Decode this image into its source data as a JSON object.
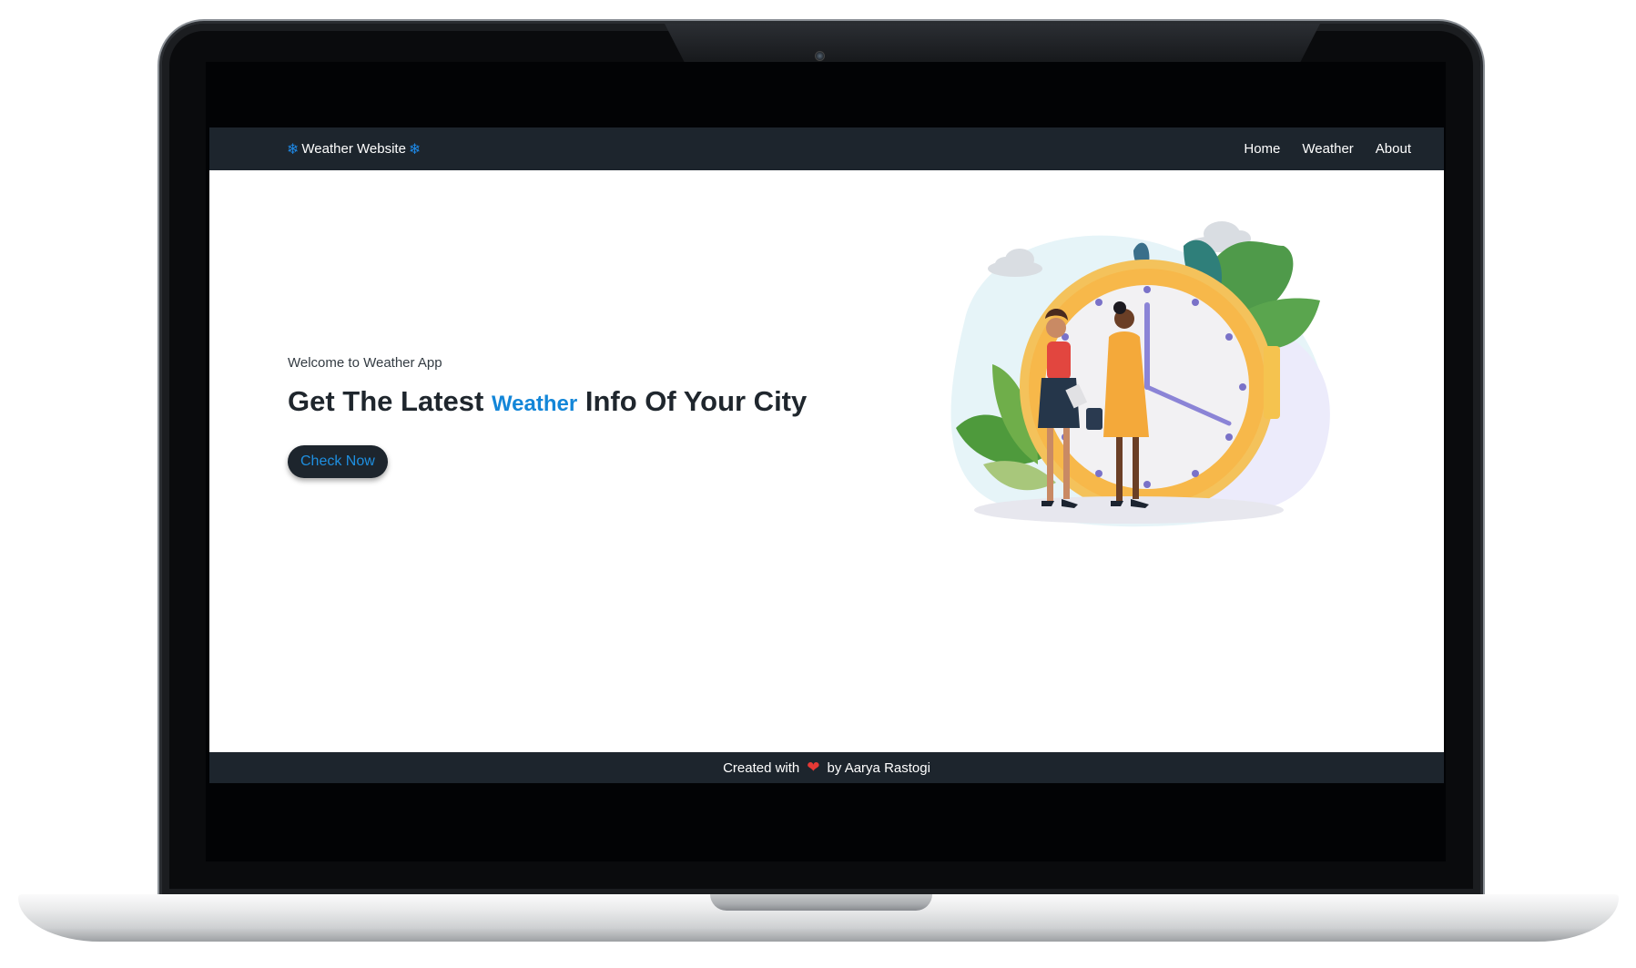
{
  "navbar": {
    "brand_text": "Weather Website",
    "brand_icon": "snowflake-icon",
    "links": [
      {
        "label": "Home"
      },
      {
        "label": "Weather"
      },
      {
        "label": "About"
      }
    ]
  },
  "hero": {
    "welcome": "Welcome to Weather App",
    "headline_start": "Get The Latest",
    "headline_accent": "Weather",
    "headline_end": "Info Of Your City",
    "button_label": "Check Now"
  },
  "footer": {
    "text_start": "Created with",
    "heart_icon": "heart-icon",
    "text_end": "by Aarya Rastogi"
  },
  "colors": {
    "navbar_bg": "#1d252d",
    "accent_blue": "#1386d8",
    "heart_red": "#e53935"
  }
}
